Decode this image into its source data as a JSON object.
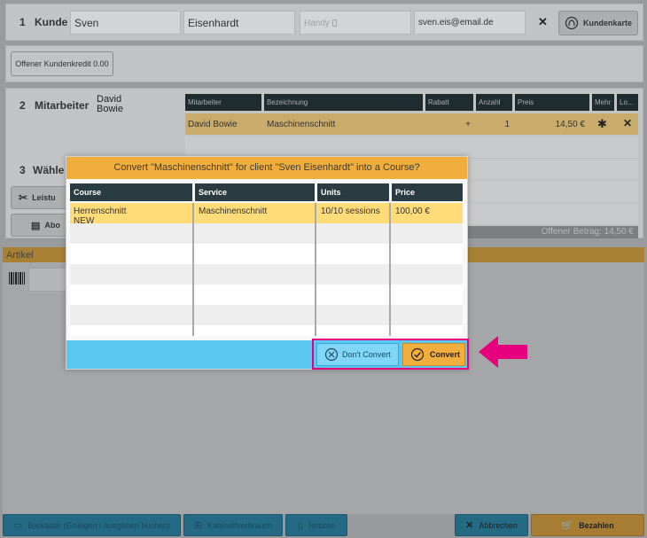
{
  "customer": {
    "step": "1",
    "label": "Kunde",
    "first_name": "Sven",
    "last_name": "Eisenhardt",
    "phone_placeholder": "Handy",
    "email": "sven.eis@email.de",
    "card_button": "Kundenkarte"
  },
  "credit": {
    "label": "Offener Kundenkredit 0.00"
  },
  "staff": {
    "step": "2",
    "label": "Mitarbeiter",
    "name_line1": "David",
    "name_line2": "Bowie"
  },
  "choose": {
    "step": "3",
    "label": "Wähle",
    "service_button": "Leistu",
    "abo_button": "Abo"
  },
  "service_table": {
    "headers": [
      "Mitarbeiter",
      "Bezeichnung",
      "Rabatt",
      "Anzahl",
      "Preis",
      "Mehr",
      "Lo..."
    ],
    "row": {
      "staff": "David Bowie",
      "name": "Maschinenschnitt",
      "discount": "+",
      "quantity": "1",
      "price": "14,50 €"
    },
    "open_amount": "Offener Betrag: 14,50 €"
  },
  "articles": {
    "label": "Artikel"
  },
  "dialog": {
    "title": "Convert \"Maschinenschnitt\" for client \"Sven Eisenhardt\" into a Course?",
    "headers": [
      "Course",
      "Service",
      "Units",
      "Price"
    ],
    "row": {
      "course_line1": "Herrenschnitt",
      "course_line2": "NEW",
      "service": "Maschinenschnitt",
      "units": "10/10 sessions",
      "price": "100,00 €"
    },
    "dont_convert": "Don't Convert",
    "convert": "Convert"
  },
  "footer": {
    "cash": "Barkasse (Einlagen / Ausgaben buchen)",
    "cabinet": "Kabinettverbrauch",
    "notes": "Notizen",
    "cancel": "Abbrechen",
    "pay": "Bezahlen"
  },
  "colors": {
    "accent_orange": "#f1ae3d",
    "highlight_pink": "#e6007e",
    "dialog_blue": "#5bc8f4",
    "selected_row": "#ffdc78"
  }
}
